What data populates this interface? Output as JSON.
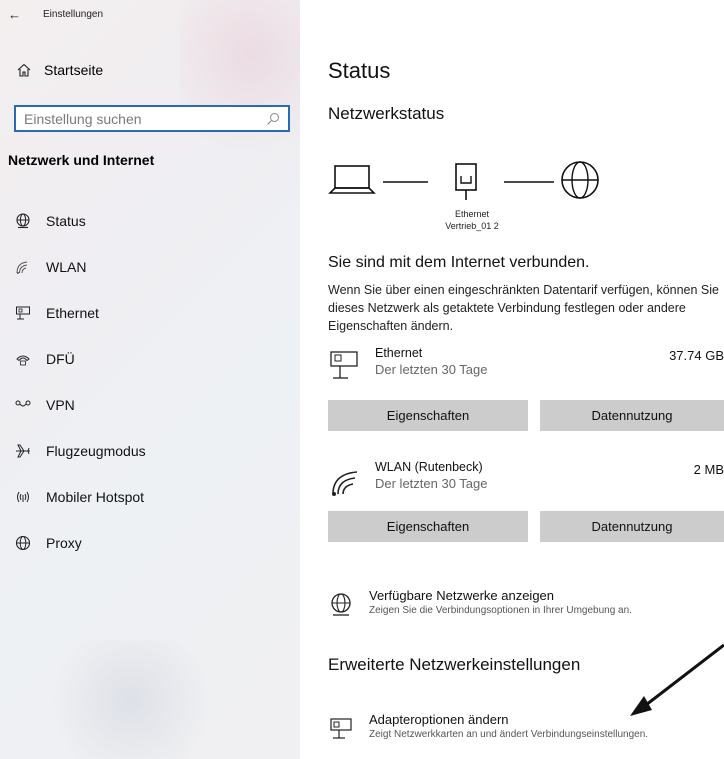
{
  "window": {
    "title": "Einstellungen"
  },
  "sidebar": {
    "home_label": "Startseite",
    "search_placeholder": "Einstellung suchen",
    "section_title": "Netzwerk und Internet",
    "items": [
      {
        "label": "Status",
        "icon": "globe-status-icon"
      },
      {
        "label": "WLAN",
        "icon": "wifi-icon"
      },
      {
        "label": "Ethernet",
        "icon": "ethernet-icon"
      },
      {
        "label": "DFÜ",
        "icon": "dialup-phone-icon"
      },
      {
        "label": "VPN",
        "icon": "vpn-icon"
      },
      {
        "label": "Flugzeugmodus",
        "icon": "airplane-icon"
      },
      {
        "label": "Mobiler Hotspot",
        "icon": "hotspot-icon"
      },
      {
        "label": "Proxy",
        "icon": "globe-icon"
      }
    ]
  },
  "main": {
    "title": "Status",
    "network_status_heading": "Netzwerkstatus",
    "diagram": {
      "adapter_type": "Ethernet",
      "adapter_name": "Vertrieb_01 2"
    },
    "connected_text": "Sie sind mit dem Internet verbunden.",
    "description": "Wenn Sie über einen eingeschränkten Datentarif verfügen, können Sie dieses Netzwerk als getaktete Verbindung festlegen oder andere Eigenschaften ändern.",
    "networks": [
      {
        "name": "Ethernet",
        "period": "Der letzten 30 Tage",
        "usage": "37.74 GB",
        "icon": "ethernet-icon",
        "properties_label": "Eigenschaften",
        "data_usage_label": "Datennutzung"
      },
      {
        "name": "WLAN (Rutenbeck)",
        "period": "Der letzten 30 Tage",
        "usage": "2 MB",
        "icon": "wifi-icon",
        "properties_label": "Eigenschaften",
        "data_usage_label": "Datennutzung"
      }
    ],
    "available_networks": {
      "title": "Verfügbare Netzwerke anzeigen",
      "subtitle": "Zeigen Sie die Verbindungsoptionen in Ihrer Umgebung an."
    },
    "advanced_heading": "Erweiterte Netzwerkeinstellungen",
    "adapter_options": {
      "title": "Adapteroptionen ändern",
      "subtitle": "Zeigt Netzwerkkarten an und ändert Verbindungseinstellungen."
    }
  },
  "colors": {
    "accent": "#2b6bb3",
    "button_bg": "#cccccc"
  }
}
